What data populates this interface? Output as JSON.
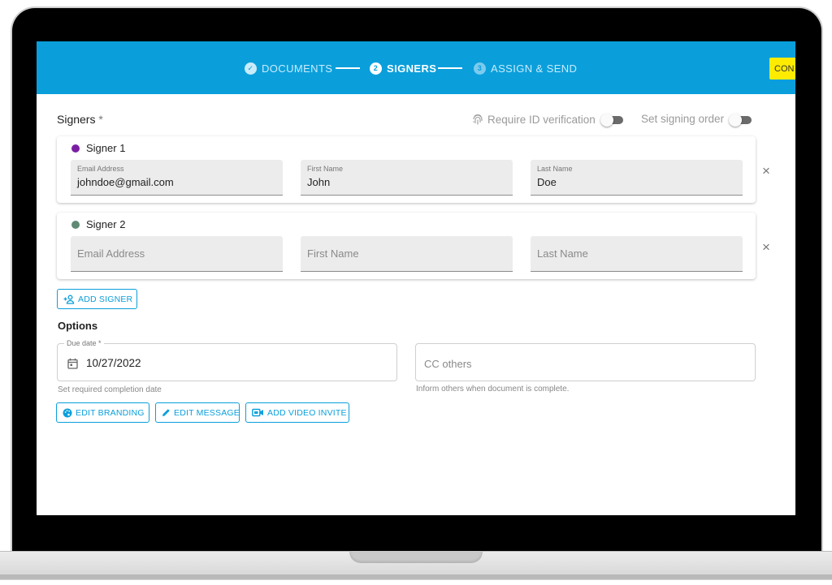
{
  "stepper": {
    "steps": [
      {
        "label": "DOCUMENTS",
        "marker": "✓",
        "state": "completed"
      },
      {
        "label": "SIGNERS",
        "marker": "2",
        "state": "active"
      },
      {
        "label": "ASSIGN & SEND",
        "marker": "3",
        "state": "upcoming"
      }
    ],
    "continue_label": "CON"
  },
  "signers_section": {
    "title": "Signers",
    "required_mark": "*",
    "require_id_label": "Require ID verification",
    "require_id_enabled": false,
    "signing_order_label": "Set signing order",
    "signing_order_enabled": false
  },
  "signers": [
    {
      "label": "Signer 1",
      "dot_color": "#7b1fa2",
      "email_label": "Email Address",
      "email_value": "johndoe@gmail.com",
      "first_label": "First Name",
      "first_value": "John",
      "last_label": "Last Name",
      "last_value": "Doe"
    },
    {
      "label": "Signer 2",
      "dot_color": "#5f8a73",
      "email_placeholder": "Email Address",
      "first_placeholder": "First Name",
      "last_placeholder": "Last Name"
    }
  ],
  "remove_icon": "×",
  "add_signer_label": "ADD SIGNER",
  "options": {
    "title": "Options",
    "due_date_label": "Due date *",
    "due_date_value": "10/27/2022",
    "due_date_help": "Set required completion date",
    "cc_placeholder": "CC others",
    "cc_help": "Inform others when document is complete."
  },
  "buttons": {
    "edit_branding": "EDIT BRANDING",
    "edit_message": "EDIT MESSAGE",
    "add_video_invite": "ADD VIDEO INVITE"
  },
  "colors": {
    "header_blue": "#0a9fdb",
    "continue_yellow": "#ffeb00"
  }
}
